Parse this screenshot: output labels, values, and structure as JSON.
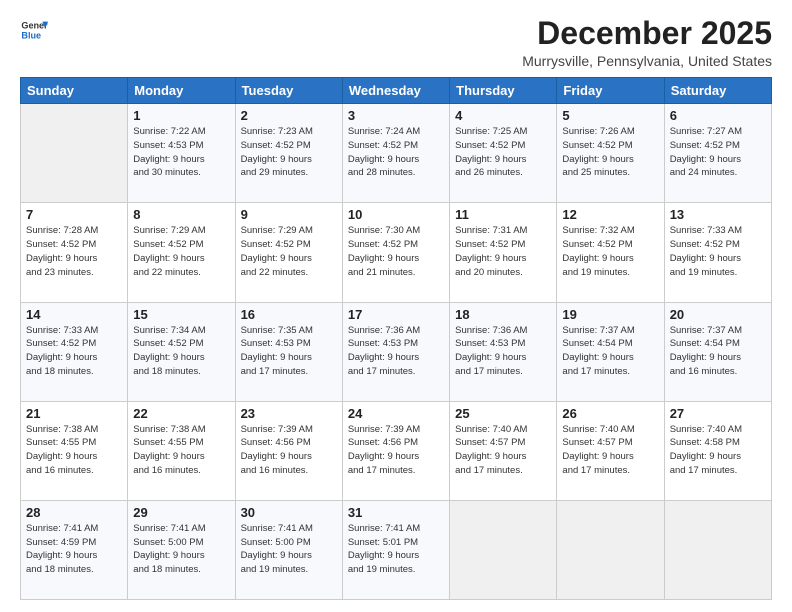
{
  "logo": {
    "line1": "General",
    "line2": "Blue",
    "icon_color": "#1a6cc4"
  },
  "title": "December 2025",
  "subtitle": "Murrysville, Pennsylvania, United States",
  "days_of_week": [
    "Sunday",
    "Monday",
    "Tuesday",
    "Wednesday",
    "Thursday",
    "Friday",
    "Saturday"
  ],
  "weeks": [
    [
      {
        "day": "",
        "info": ""
      },
      {
        "day": "1",
        "info": "Sunrise: 7:22 AM\nSunset: 4:53 PM\nDaylight: 9 hours\nand 30 minutes."
      },
      {
        "day": "2",
        "info": "Sunrise: 7:23 AM\nSunset: 4:52 PM\nDaylight: 9 hours\nand 29 minutes."
      },
      {
        "day": "3",
        "info": "Sunrise: 7:24 AM\nSunset: 4:52 PM\nDaylight: 9 hours\nand 28 minutes."
      },
      {
        "day": "4",
        "info": "Sunrise: 7:25 AM\nSunset: 4:52 PM\nDaylight: 9 hours\nand 26 minutes."
      },
      {
        "day": "5",
        "info": "Sunrise: 7:26 AM\nSunset: 4:52 PM\nDaylight: 9 hours\nand 25 minutes."
      },
      {
        "day": "6",
        "info": "Sunrise: 7:27 AM\nSunset: 4:52 PM\nDaylight: 9 hours\nand 24 minutes."
      }
    ],
    [
      {
        "day": "7",
        "info": "Sunrise: 7:28 AM\nSunset: 4:52 PM\nDaylight: 9 hours\nand 23 minutes."
      },
      {
        "day": "8",
        "info": "Sunrise: 7:29 AM\nSunset: 4:52 PM\nDaylight: 9 hours\nand 22 minutes."
      },
      {
        "day": "9",
        "info": "Sunrise: 7:29 AM\nSunset: 4:52 PM\nDaylight: 9 hours\nand 22 minutes."
      },
      {
        "day": "10",
        "info": "Sunrise: 7:30 AM\nSunset: 4:52 PM\nDaylight: 9 hours\nand 21 minutes."
      },
      {
        "day": "11",
        "info": "Sunrise: 7:31 AM\nSunset: 4:52 PM\nDaylight: 9 hours\nand 20 minutes."
      },
      {
        "day": "12",
        "info": "Sunrise: 7:32 AM\nSunset: 4:52 PM\nDaylight: 9 hours\nand 19 minutes."
      },
      {
        "day": "13",
        "info": "Sunrise: 7:33 AM\nSunset: 4:52 PM\nDaylight: 9 hours\nand 19 minutes."
      }
    ],
    [
      {
        "day": "14",
        "info": "Sunrise: 7:33 AM\nSunset: 4:52 PM\nDaylight: 9 hours\nand 18 minutes."
      },
      {
        "day": "15",
        "info": "Sunrise: 7:34 AM\nSunset: 4:52 PM\nDaylight: 9 hours\nand 18 minutes."
      },
      {
        "day": "16",
        "info": "Sunrise: 7:35 AM\nSunset: 4:53 PM\nDaylight: 9 hours\nand 17 minutes."
      },
      {
        "day": "17",
        "info": "Sunrise: 7:36 AM\nSunset: 4:53 PM\nDaylight: 9 hours\nand 17 minutes."
      },
      {
        "day": "18",
        "info": "Sunrise: 7:36 AM\nSunset: 4:53 PM\nDaylight: 9 hours\nand 17 minutes."
      },
      {
        "day": "19",
        "info": "Sunrise: 7:37 AM\nSunset: 4:54 PM\nDaylight: 9 hours\nand 17 minutes."
      },
      {
        "day": "20",
        "info": "Sunrise: 7:37 AM\nSunset: 4:54 PM\nDaylight: 9 hours\nand 16 minutes."
      }
    ],
    [
      {
        "day": "21",
        "info": "Sunrise: 7:38 AM\nSunset: 4:55 PM\nDaylight: 9 hours\nand 16 minutes."
      },
      {
        "day": "22",
        "info": "Sunrise: 7:38 AM\nSunset: 4:55 PM\nDaylight: 9 hours\nand 16 minutes."
      },
      {
        "day": "23",
        "info": "Sunrise: 7:39 AM\nSunset: 4:56 PM\nDaylight: 9 hours\nand 16 minutes."
      },
      {
        "day": "24",
        "info": "Sunrise: 7:39 AM\nSunset: 4:56 PM\nDaylight: 9 hours\nand 17 minutes."
      },
      {
        "day": "25",
        "info": "Sunrise: 7:40 AM\nSunset: 4:57 PM\nDaylight: 9 hours\nand 17 minutes."
      },
      {
        "day": "26",
        "info": "Sunrise: 7:40 AM\nSunset: 4:57 PM\nDaylight: 9 hours\nand 17 minutes."
      },
      {
        "day": "27",
        "info": "Sunrise: 7:40 AM\nSunset: 4:58 PM\nDaylight: 9 hours\nand 17 minutes."
      }
    ],
    [
      {
        "day": "28",
        "info": "Sunrise: 7:41 AM\nSunset: 4:59 PM\nDaylight: 9 hours\nand 18 minutes."
      },
      {
        "day": "29",
        "info": "Sunrise: 7:41 AM\nSunset: 5:00 PM\nDaylight: 9 hours\nand 18 minutes."
      },
      {
        "day": "30",
        "info": "Sunrise: 7:41 AM\nSunset: 5:00 PM\nDaylight: 9 hours\nand 19 minutes."
      },
      {
        "day": "31",
        "info": "Sunrise: 7:41 AM\nSunset: 5:01 PM\nDaylight: 9 hours\nand 19 minutes."
      },
      {
        "day": "",
        "info": ""
      },
      {
        "day": "",
        "info": ""
      },
      {
        "day": "",
        "info": ""
      }
    ]
  ]
}
